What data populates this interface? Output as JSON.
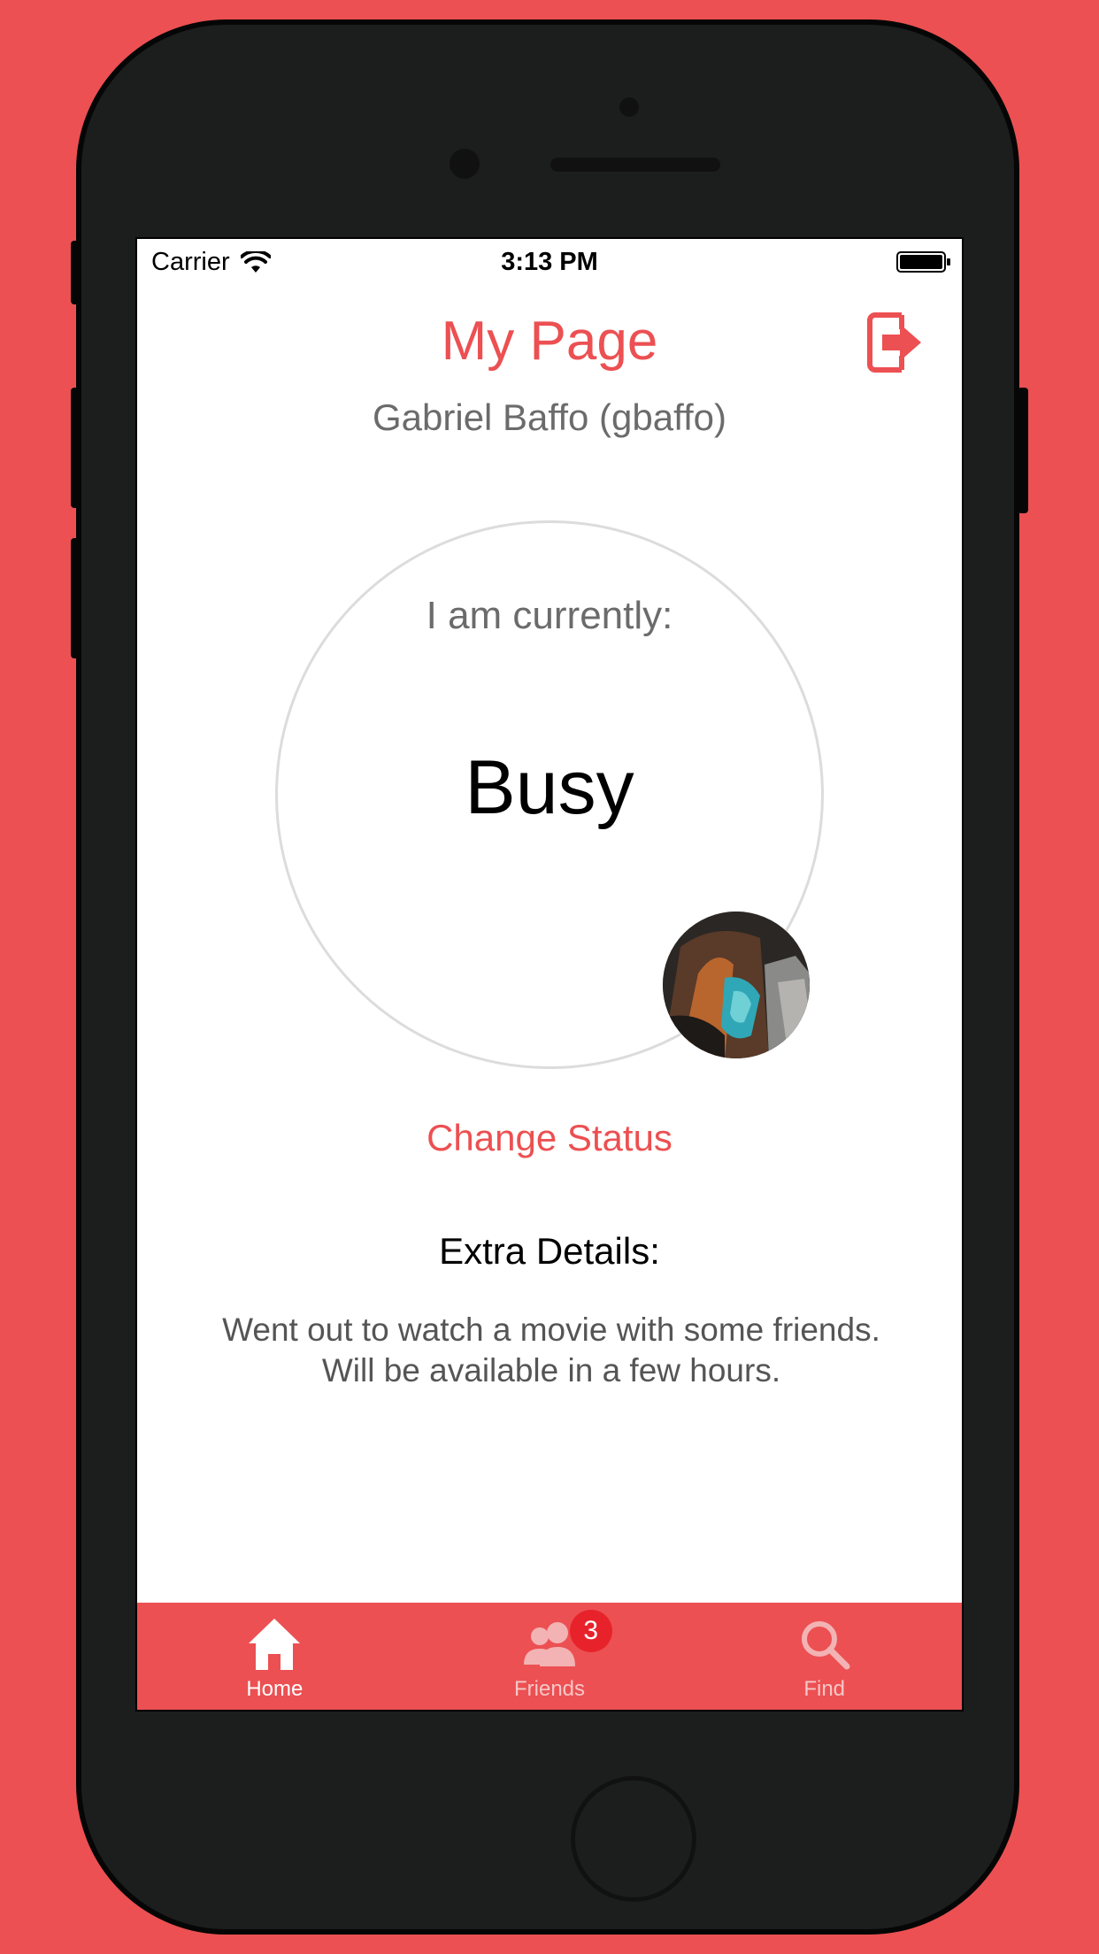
{
  "colors": {
    "background": "#ec5052",
    "accent": "#ec5052",
    "tab_bar": "#ec5052",
    "badge": "#e8222b",
    "phone_body": "#1c1e1e"
  },
  "status_bar": {
    "carrier": "Carrier",
    "time": "3:13 PM",
    "icons": [
      "wifi-icon",
      "battery-icon"
    ]
  },
  "header": {
    "title": "My Page",
    "logout_icon": "logout-icon",
    "user_name": "Gabriel Baffo (gbaffo)"
  },
  "status": {
    "label": "I am currently:",
    "value": "Busy",
    "change_label": "Change Status"
  },
  "extra": {
    "heading": "Extra Details:",
    "line1": "Went out to watch a movie with some friends.",
    "line2": "Will be available in a few hours."
  },
  "tabs": [
    {
      "label": "Home",
      "icon": "home-icon",
      "active": true
    },
    {
      "label": "Friends",
      "icon": "friends-icon",
      "active": false,
      "badge": "3"
    },
    {
      "label": "Find",
      "icon": "search-icon",
      "active": false
    }
  ]
}
